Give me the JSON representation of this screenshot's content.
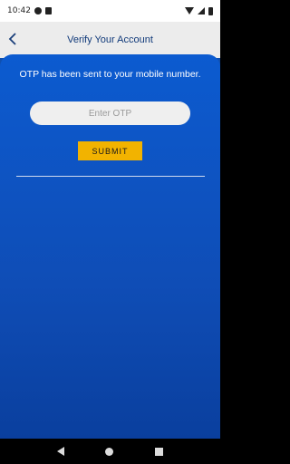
{
  "status_bar": {
    "time": "10:42",
    "left_icons": [
      "circle-status-icon",
      "sd-card-icon"
    ],
    "right_icons": [
      "wifi-icon",
      "signal-icon",
      "battery-icon"
    ]
  },
  "app_bar": {
    "title": "Verify Your Account",
    "back_icon": "chevron-left-icon"
  },
  "main": {
    "message": "OTP has been sent to your mobile number.",
    "otp_placeholder": "Enter OTP",
    "otp_value": "",
    "submit_label": "SUBMIT"
  },
  "colors": {
    "accent": "#f2b300",
    "background": "#0f4db6",
    "app_bar": "#ececec"
  },
  "nav_bar": {
    "icons": [
      "nav-back-icon",
      "nav-home-icon",
      "nav-recent-icon"
    ]
  }
}
